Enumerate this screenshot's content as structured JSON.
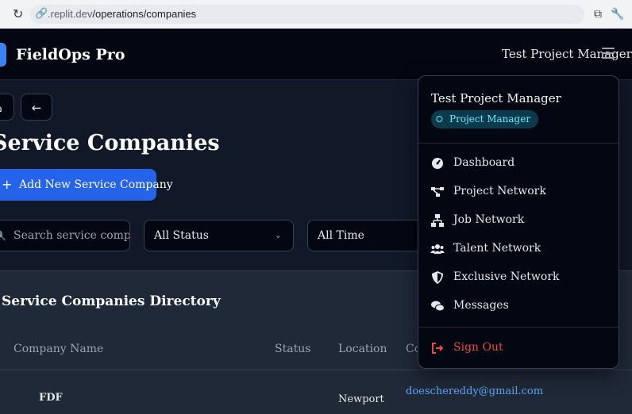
{
  "browser": {
    "url_prefix": ".replit.dev",
    "url_path": "/operations/companies"
  },
  "app": {
    "brand": "FieldOps Pro",
    "user_name": "Test Project Manager"
  },
  "page": {
    "title": "Service Companies",
    "add_button": "Add New Service Company",
    "search_placeholder": "Search service companies...",
    "status_filter": "All Status",
    "time_filter": "All Time"
  },
  "directory": {
    "title": "Service Companies Directory",
    "columns": [
      "Company Name",
      "Status",
      "Location",
      "Co"
    ],
    "first_row": {
      "company": "FDF",
      "location": "Newport",
      "email": "doeschereddy@gmail.com"
    }
  },
  "user_menu": {
    "name": "Test Project Manager",
    "role": "Project Manager",
    "items": [
      {
        "label": "Dashboard",
        "icon": "dashboard-icon"
      },
      {
        "label": "Project Network",
        "icon": "project-network-icon"
      },
      {
        "label": "Job Network",
        "icon": "job-network-icon"
      },
      {
        "label": "Talent Network",
        "icon": "users-icon"
      },
      {
        "label": "Exclusive Network",
        "icon": "shield-icon"
      },
      {
        "label": "Messages",
        "icon": "messages-icon"
      }
    ],
    "sign_out": "Sign Out"
  },
  "colors": {
    "accent": "#2563eb",
    "danger": "#ef4444",
    "badge_text": "#67e8f9"
  }
}
